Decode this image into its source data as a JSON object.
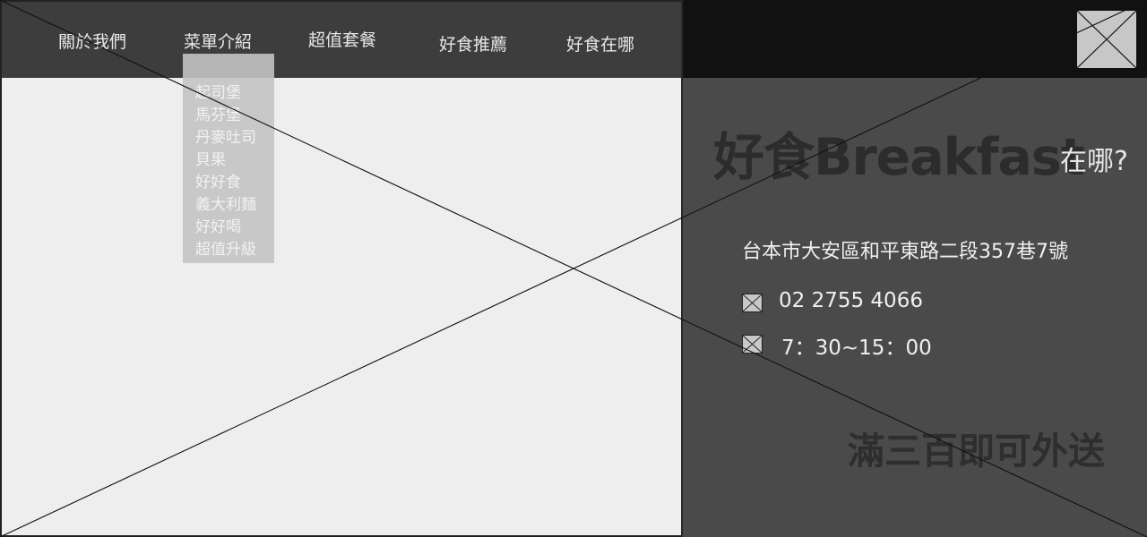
{
  "nav": {
    "items": [
      "關於我們",
      "菜單介紹",
      "超值套餐",
      "好食推薦",
      "好食在哪"
    ]
  },
  "dropdown": {
    "items": [
      "起司堡",
      "馬芬堡",
      "丹麥吐司",
      "貝果",
      "好好食",
      "義大利麵",
      "好好喝",
      "超值升級"
    ]
  },
  "info": {
    "title_main": "好食Breakfast",
    "title_sub": "在哪?",
    "address": "台本市大安區和平東路二段357巷7號",
    "phone": "02 2755 4066",
    "hours": "7：30~15：00",
    "delivery": "滿三百即可外送"
  },
  "colors": {
    "nav_bg": "#3d3d3d",
    "panel_bg": "#4a4a4a",
    "map_bg": "#eeeeee",
    "dropdown_bg": "#c8c8c8"
  },
  "icons": {
    "phone": "image-placeholder-icon",
    "hours": "image-placeholder-icon",
    "close": "image-placeholder-box"
  }
}
